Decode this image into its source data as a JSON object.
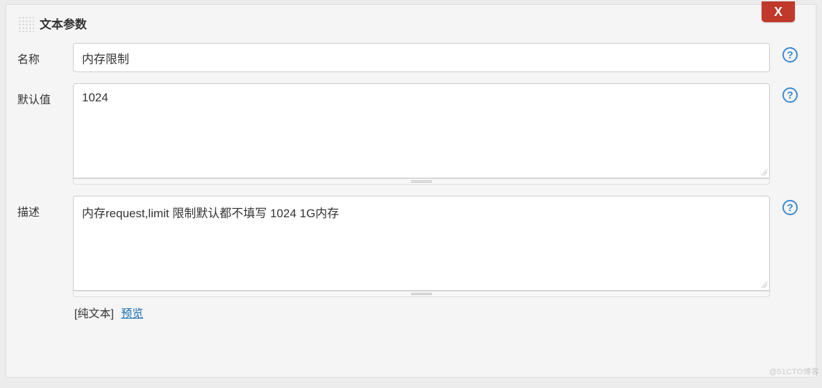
{
  "panel": {
    "title": "文本参数",
    "close_label": "X"
  },
  "fields": {
    "name": {
      "label": "名称",
      "value": "内存限制"
    },
    "default": {
      "label": "默认值",
      "value": "1024"
    },
    "description": {
      "label": "描述",
      "value": "内存request,limit 限制默认都不填写 1024 1G内存"
    }
  },
  "preview": {
    "plain_text_label": "[纯文本]",
    "preview_link": "预览"
  },
  "help": {
    "glyph": "?"
  },
  "watermark": "@51CTO博客"
}
